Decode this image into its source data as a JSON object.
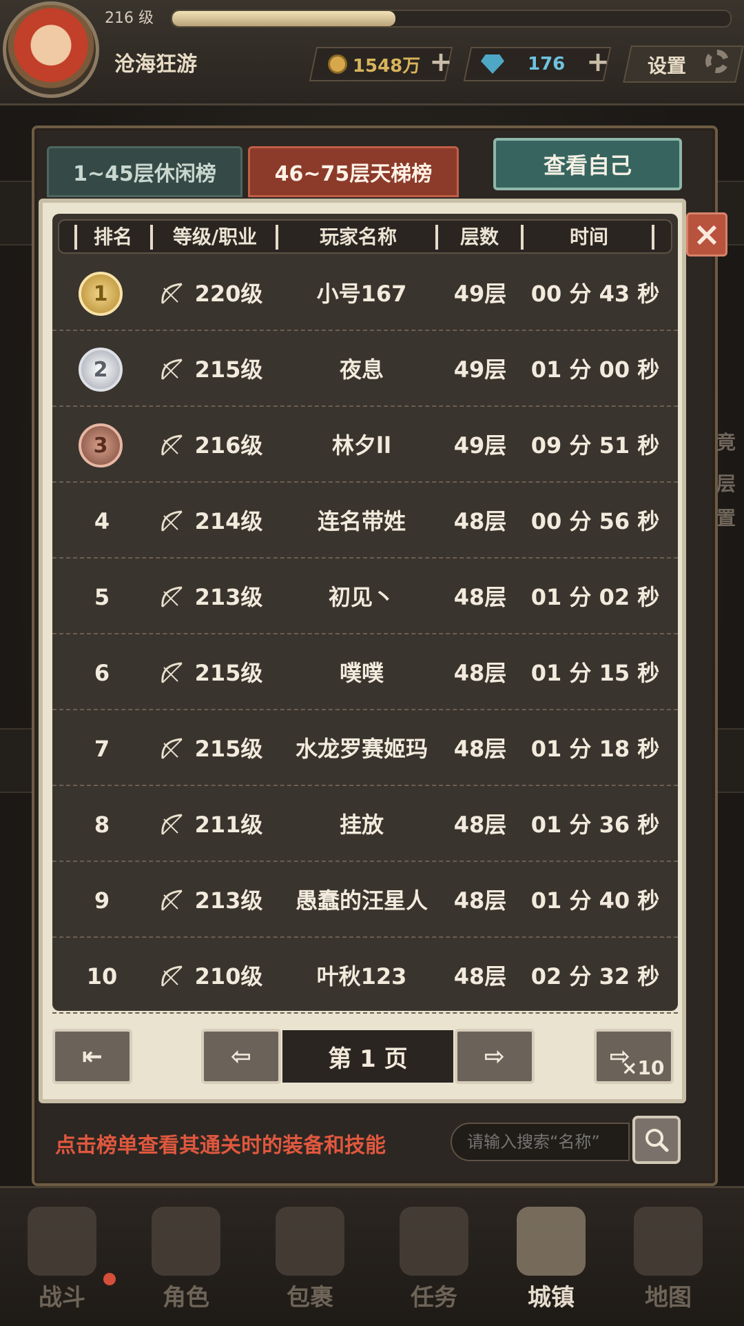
{
  "header": {
    "level": "216 级",
    "exp_progress": 0.4,
    "player_name": "沧海狂游",
    "gold": "1548万",
    "gems": "176",
    "settings_label": "设置"
  },
  "tabs": {
    "casual": "1~45层休闲榜",
    "ladder": "46~75层天梯榜"
  },
  "view_self_label": "查看自己",
  "table": {
    "headers": [
      "排名",
      "等级/职业",
      "玩家名称",
      "层数",
      "时间"
    ],
    "rows": [
      {
        "rank": "1",
        "level": "220级",
        "name": "小号167",
        "floor": "49层",
        "time": "00 分 43 秒"
      },
      {
        "rank": "2",
        "level": "215级",
        "name": "夜息",
        "floor": "49层",
        "time": "01 分 00 秒"
      },
      {
        "rank": "3",
        "level": "216级",
        "name": "林夕ll",
        "floor": "49层",
        "time": "09 分 51 秒"
      },
      {
        "rank": "4",
        "level": "214级",
        "name": "连名带姓",
        "floor": "48层",
        "time": "00 分 56 秒"
      },
      {
        "rank": "5",
        "level": "213级",
        "name": "初见丶",
        "floor": "48层",
        "time": "01 分 02 秒"
      },
      {
        "rank": "6",
        "level": "215级",
        "name": "噗噗",
        "floor": "48层",
        "time": "01 分 15 秒"
      },
      {
        "rank": "7",
        "level": "215级",
        "name": "水龙罗赛姬玛",
        "floor": "48层",
        "time": "01 分 18 秒"
      },
      {
        "rank": "8",
        "level": "211级",
        "name": "挂放",
        "floor": "48层",
        "time": "01 分 36 秒"
      },
      {
        "rank": "9",
        "level": "213级",
        "name": "愚蠢的汪星人",
        "floor": "48层",
        "time": "01 分 40 秒"
      },
      {
        "rank": "10",
        "level": "210级",
        "name": "叶秋123",
        "floor": "48层",
        "time": "02 分 32 秒"
      }
    ]
  },
  "pagination": {
    "page_label": "第 1 页",
    "jump_label": "×10"
  },
  "hint": "点击榜单查看其通关时的装备和技能",
  "search": {
    "placeholder": "请输入搜索“名称”"
  },
  "nav": [
    "战斗",
    "角色",
    "包裹",
    "任务",
    "城镇",
    "地图"
  ]
}
